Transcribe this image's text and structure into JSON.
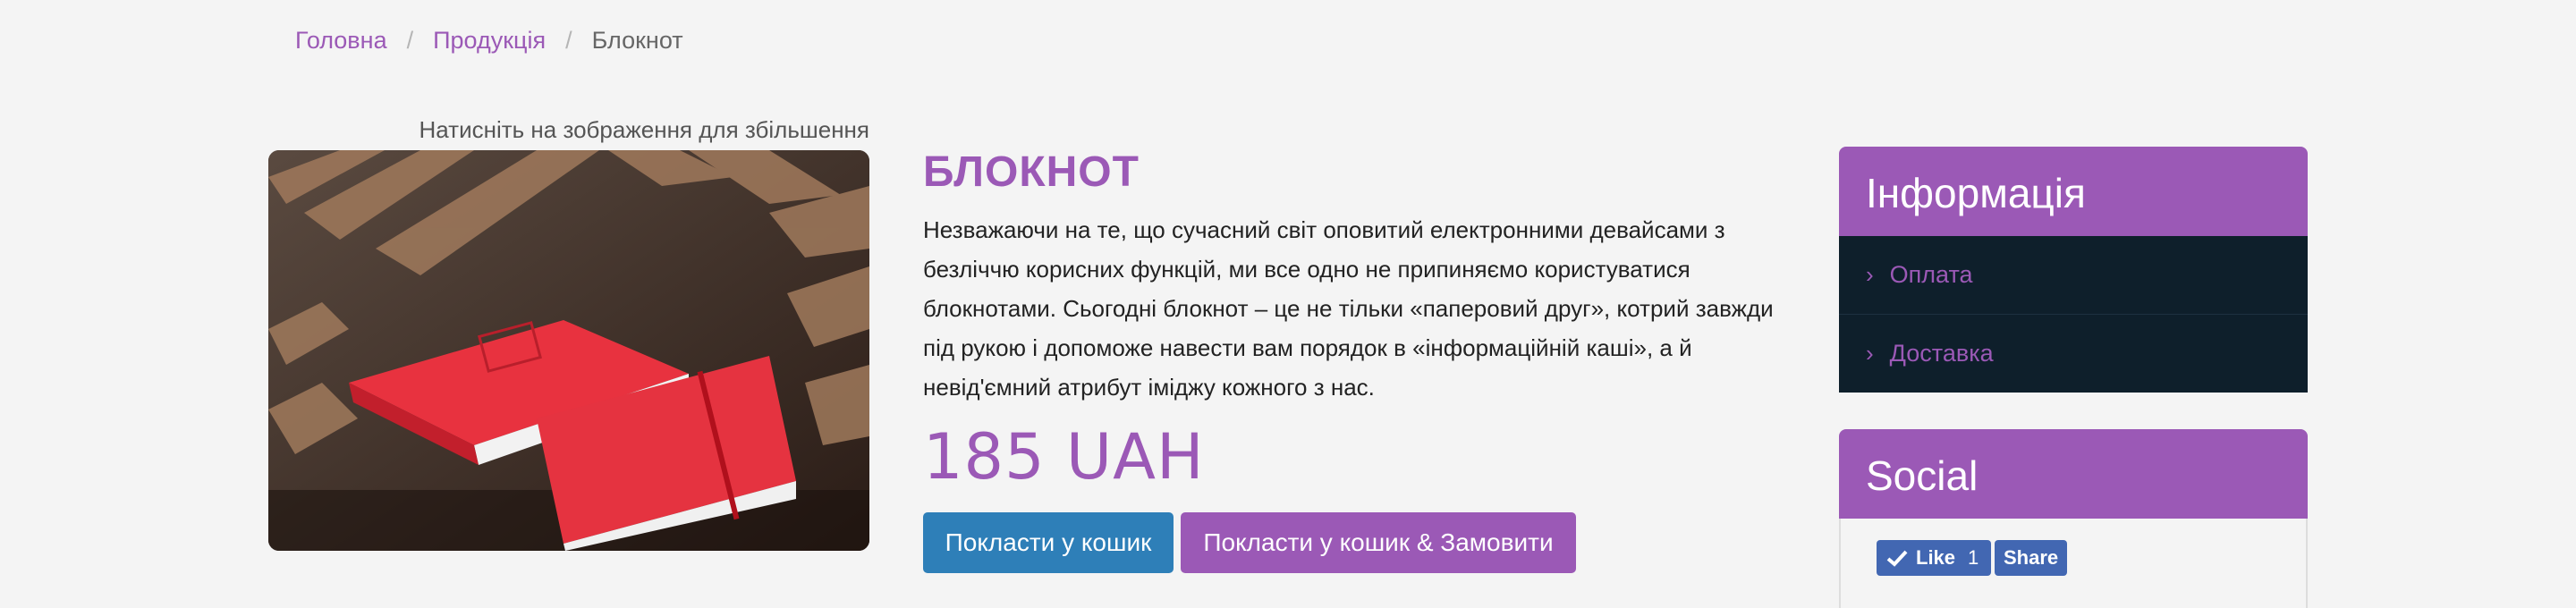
{
  "breadcrumb": {
    "home": "Головна",
    "products": "Продукція",
    "current": "Блокнот",
    "separator": "/"
  },
  "product": {
    "zoom_hint": "Натисніть на зображення для збільшення",
    "title": "БЛОКНОТ",
    "description": "Незважаючи на те, що сучасний світ оповитий електронними девайсами з безліччю корисних функцій, ми все одно не припиняємо користуватися блокнотами. Сьогодні блокнот – це не тільки «паперовий друг», котрий завжди під рукою і допоможе навести вам порядок в «інформаційній каші», а й невід'ємний атрибут іміджу кожного з нас.",
    "price": "185 UAH",
    "add_to_cart_label": "Покласти у кошик",
    "add_and_order_label": "Покласти у кошик & Замовити"
  },
  "info_panel": {
    "title": "Інформація",
    "items": [
      {
        "label": "Оплата",
        "icon": "chevron-right-icon"
      },
      {
        "label": "Доставка",
        "icon": "chevron-right-icon"
      }
    ]
  },
  "social_panel": {
    "title": "Social",
    "like_label": "Like",
    "like_count": "1",
    "share_label": "Share"
  },
  "colors": {
    "accent": "#9b59b6",
    "primary_button": "#2e7fb8",
    "info_list_bg": "#0e1f2b",
    "facebook": "#4267b2",
    "page_bg": "#f4f4f4"
  }
}
